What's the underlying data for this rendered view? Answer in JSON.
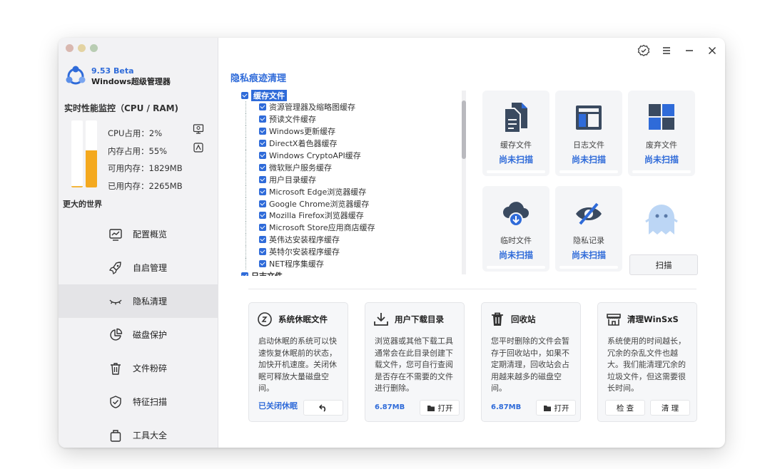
{
  "app": {
    "version": "9.53 Beta",
    "name": "Windows超级管理器"
  },
  "perf": {
    "title": "实时性能监控（CPU / RAM)",
    "cpu_label": "CPU占用：2%",
    "mem_label": "内存占用：55%",
    "avail_label": "可用内存：1829MB",
    "used_label": "已用内存：2265MB",
    "cpu_percent": 2,
    "mem_percent": 55
  },
  "sidebar": {
    "slogan": "更大的世界",
    "items": [
      {
        "label": "配置概览",
        "icon": "chart-line-icon"
      },
      {
        "label": "自启管理",
        "icon": "rocket-icon"
      },
      {
        "label": "隐私清理",
        "icon": "eye-closed-icon"
      },
      {
        "label": "磁盘保护",
        "icon": "pie-chart-icon"
      },
      {
        "label": "文件粉碎",
        "icon": "trash-icon"
      },
      {
        "label": "特征扫描",
        "icon": "shield-check-icon"
      },
      {
        "label": "工具大全",
        "icon": "toolbox-icon"
      }
    ]
  },
  "main": {
    "title": "隐私痕迹清理",
    "tree": {
      "root": "缓存文件",
      "children": [
        "资源管理器及缩略图缓存",
        "预读文件缓存",
        "Windows更新缓存",
        "DirectX着色器缓存",
        "Windows CryptoAPI缓存",
        "微软账户服务缓存",
        "用户目录缓存",
        "Microsoft Edge浏览器缓存",
        "Google Chrome浏览器缓存",
        "Mozilla Firefox浏览器缓存",
        "Microsoft Store应用商店缓存",
        "英伟达安装程序缓存",
        "英特尔安装程序缓存",
        "NET程序集缓存"
      ],
      "next_root": "日志文件"
    },
    "categories": [
      {
        "name": "缓存文件",
        "status": "尚未扫描",
        "icon": "document-stack-icon"
      },
      {
        "name": "日志文件",
        "status": "尚未扫描",
        "icon": "log-window-icon"
      },
      {
        "name": "废弃文件",
        "status": "尚未扫描",
        "icon": "grid-icon"
      },
      {
        "name": "临时文件",
        "status": "尚未扫描",
        "icon": "cloud-download-icon"
      },
      {
        "name": "隐私记录",
        "status": "尚未扫描",
        "icon": "eye-slash-icon"
      }
    ],
    "scan_button": "扫描",
    "tools": [
      {
        "title": "系统休眠文件",
        "desc": "启动休眠的系统可以快速恢复休眠前的状态，加快开机速度。关闭休眠可释放大量磁盘空间。",
        "link": "已关闭休眠",
        "icon": "sleep-icon"
      },
      {
        "title": "用户下载目录",
        "desc": "浏览器或其他下载工具通常会在此目录创建下载文件，您可自行查阅是否存在不需要的文件进行删除。",
        "size": "6.87MB",
        "button": "打开",
        "icon": "download-tray-icon"
      },
      {
        "title": "回收站",
        "desc": "您平时删除的文件会暂存于回收站中，如果不定期清理，回收站会占用越来越多的磁盘空间。",
        "size": "6.87MB",
        "button": "打开",
        "icon": "trash-icon"
      },
      {
        "title": "清理WinSxS",
        "desc": "系统使用的时间越长，冗余的杂乱文件也越大。我们能清理冗余的垃圾文件，但这需要很长时间。",
        "button1": "检 查",
        "button2": "清 理",
        "icon": "shop-icon"
      }
    ]
  },
  "colors": {
    "accent": "#2f6bd9",
    "bar": "#f4a91f",
    "icon": "#3a4a60"
  }
}
